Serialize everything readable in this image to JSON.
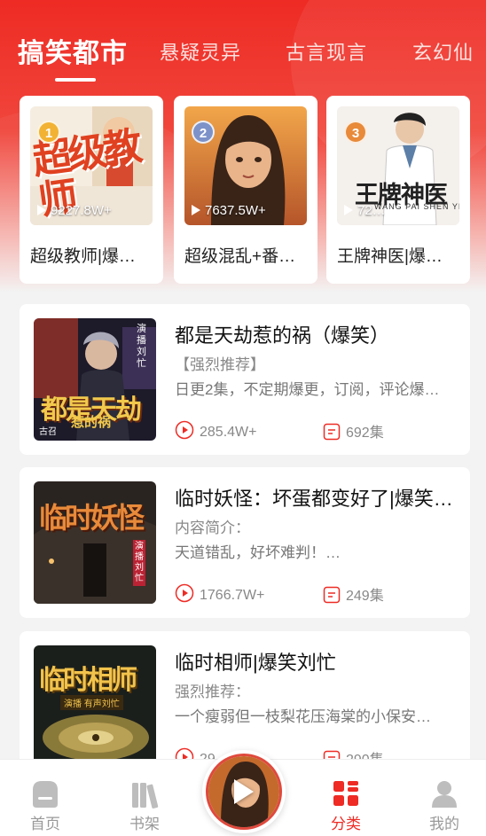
{
  "tabs": [
    {
      "label": "搞笑都市",
      "active": true
    },
    {
      "label": "悬疑灵异",
      "active": false
    },
    {
      "label": "古言现言",
      "active": false
    },
    {
      "label": "玄幻仙",
      "active": false
    }
  ],
  "top_books": [
    {
      "rank": "1",
      "rank_color": "#f2b233",
      "plays": "9227.8W+",
      "title": "超级教师|爆…",
      "cover_text": "超级教师"
    },
    {
      "rank": "2",
      "rank_color": "#7d92c8",
      "plays": "7637.5W+",
      "title": "超级混乱+番…",
      "cover_text": ""
    },
    {
      "rank": "3",
      "rank_color": "#e88a3a",
      "plays": "72…",
      "title": "王牌神医|爆…",
      "cover_text": "王牌神医",
      "cover_subtext": "WANG PAI SHEN YI"
    }
  ],
  "books": [
    {
      "title": "都是天劫惹的祸（爆笑）",
      "subtitle": "【强烈推荐】",
      "desc": "日更2集，不定期爆更，订阅，评论爆…",
      "plays": "285.4W+",
      "episodes": "692集",
      "cover_text": "都是天劫",
      "cover_text2": "惹的祸",
      "cover_narrator": "演播 刘忙",
      "cover_author": "古召"
    },
    {
      "title": "临时妖怪：坏蛋都变好了|爆笑…",
      "subtitle": "内容简介：",
      "desc": "天道错乱，好坏难判！…",
      "plays": "1766.7W+",
      "episodes": "249集",
      "cover_text": "临时妖怪",
      "cover_narrator": "演播 刘忙"
    },
    {
      "title": "临时相师|爆笑刘忙",
      "subtitle": "强烈推荐：",
      "desc": "一个瘦弱但一枝梨花压海棠的小保安…",
      "plays": "29…",
      "episodes": "290集",
      "cover_text": "临时相师",
      "cover_narrator": "演播 有声刘忙"
    }
  ],
  "nav": {
    "home": "首页",
    "shelf": "书架",
    "category": "分类",
    "mine": "我的"
  },
  "colors": {
    "accent": "#ee2b24",
    "muted": "#999999"
  }
}
